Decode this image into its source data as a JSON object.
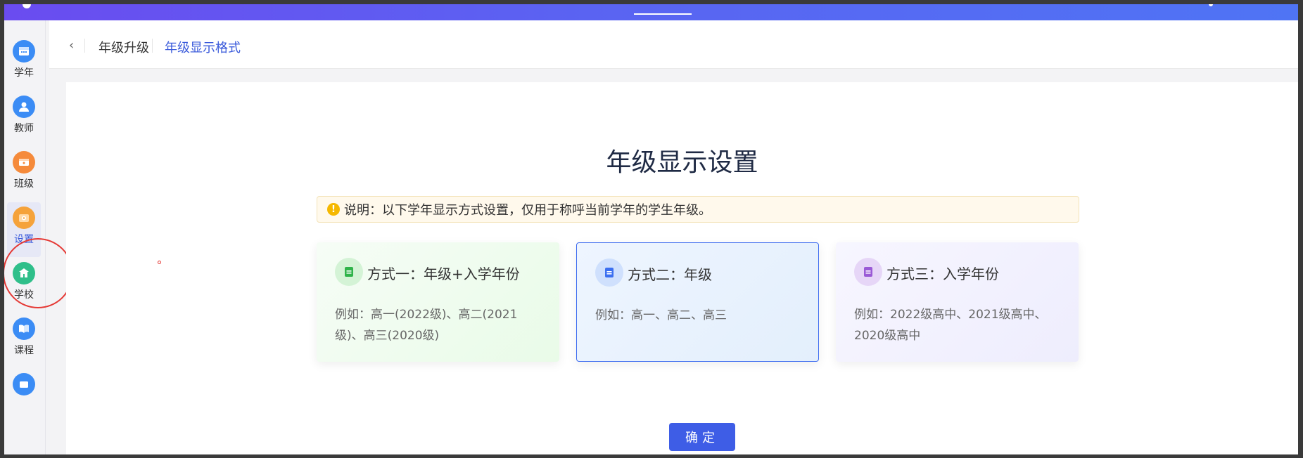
{
  "sidebar": {
    "items": [
      {
        "label": "学年",
        "icon": "calendar-icon",
        "color": "#3b8cf5"
      },
      {
        "label": "教师",
        "icon": "teacher-icon",
        "color": "#3b8cf5"
      },
      {
        "label": "班级",
        "icon": "classroom-icon",
        "color": "#f58a3b"
      },
      {
        "label": "设置",
        "icon": "settings-icon",
        "color": "#f5a23b",
        "active": true
      },
      {
        "label": "学校",
        "icon": "school-icon",
        "color": "#2fbf8a"
      },
      {
        "label": "课程",
        "icon": "book-icon",
        "color": "#3b8cf5"
      },
      {
        "label": "",
        "icon": "more-icon",
        "color": "#3b8cf5"
      }
    ]
  },
  "header": {
    "back_icon": "chevron-left-icon",
    "tabs": [
      {
        "label": "年级升级",
        "active": false
      },
      {
        "label": "年级显示格式",
        "active": true
      }
    ]
  },
  "main": {
    "title": "年级显示设置",
    "notice": {
      "icon": "warning-icon",
      "text": "说明：以下学年显示方式设置，仅用于称呼当前学年的学生年级。"
    },
    "options": [
      {
        "title": "方式一：年级+入学年份",
        "desc": "例如：高一(2022级)、高二(2021级)、高三(2020级)",
        "icon": "document-icon",
        "icon_color": "#2fb34a",
        "selected": false
      },
      {
        "title": "方式二：年级",
        "desc": "例如：高一、高二、高三",
        "icon": "document-icon",
        "icon_color": "#3b6ff0",
        "selected": true
      },
      {
        "title": "方式三：入学年份",
        "desc": "例如：2022级高中、2021级高中、2020级高中",
        "icon": "document-icon",
        "icon_color": "#9a5ad6",
        "selected": false
      }
    ],
    "confirm_label": "确定"
  },
  "colors": {
    "accent": "#3e5de6",
    "topbar_start": "#6a4cf0",
    "topbar_end": "#4f74f4",
    "highlight": "#e53935"
  }
}
